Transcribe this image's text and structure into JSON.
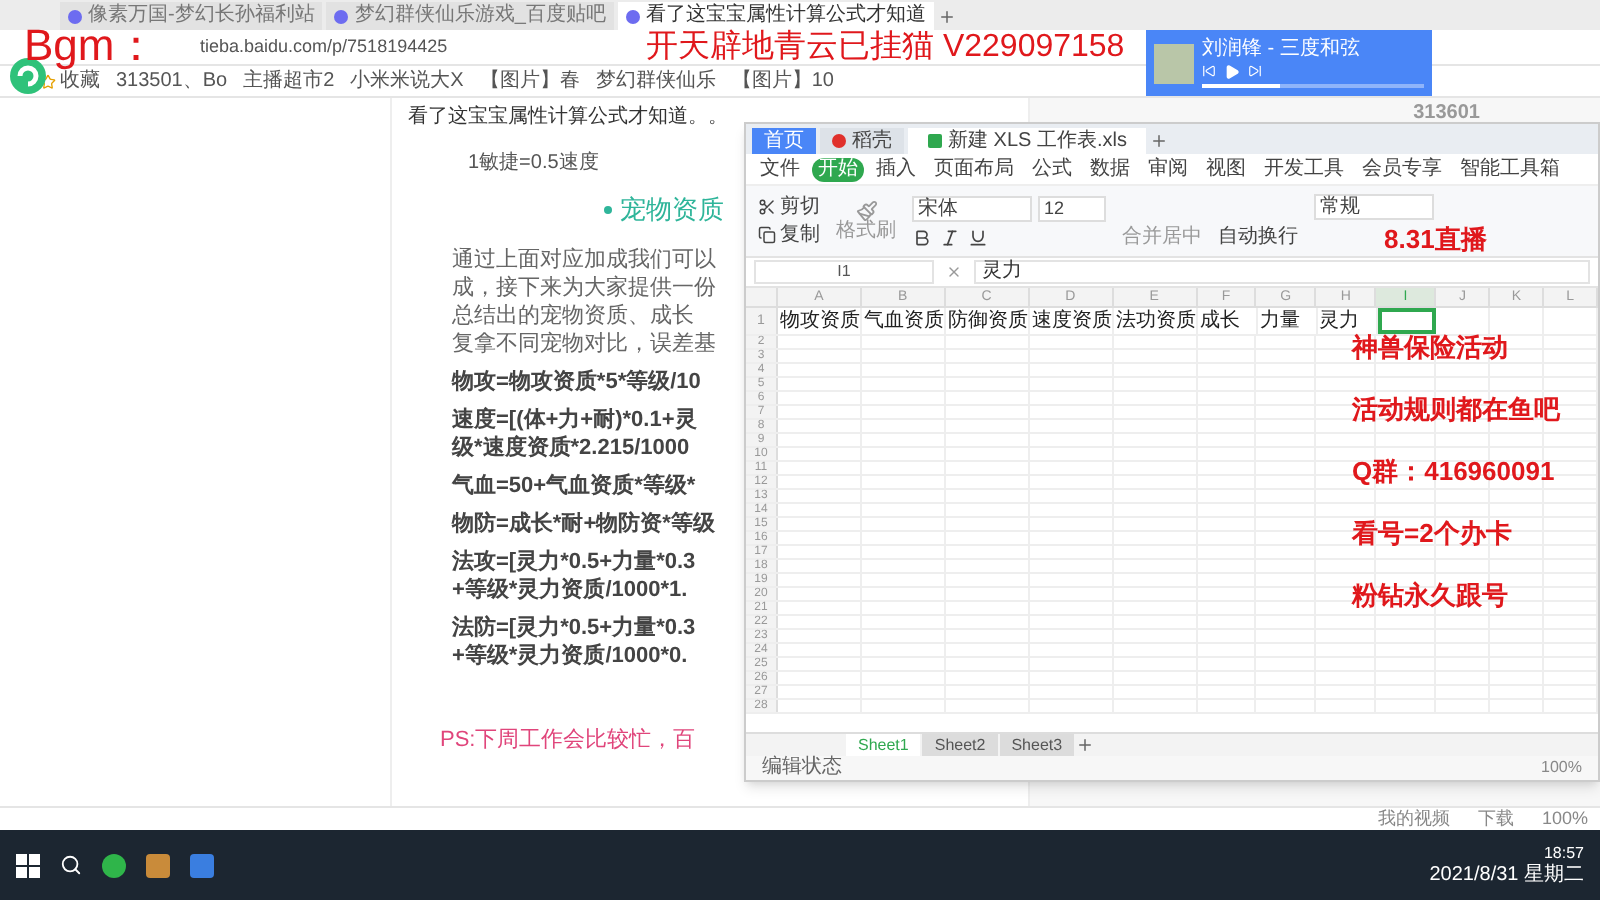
{
  "browser": {
    "tabs": [
      {
        "title": "像素万国-梦幻长孙福利站",
        "selected": false
      },
      {
        "title": "梦幻群侠仙乐游戏_百度贴吧",
        "selected": false
      },
      {
        "title": "看了这宝宝属性计算公式才知道",
        "selected": true
      }
    ],
    "address": "tieba.baidu.com/p/7518194425",
    "bookmarks": [
      "收藏",
      "313501、Bo",
      "主播超市2",
      "小米米说大X",
      "【图片】春",
      "梦幻群侠仙乐",
      "【图片】10"
    ],
    "side_number": "313601",
    "status_items": [
      "我的视频",
      "下载",
      "100%"
    ]
  },
  "article": {
    "title": "看了这宝宝属性计算公式才知道。。",
    "top_line": "1敏捷=0.5速度",
    "section": "宠物资质",
    "blocks": [
      {
        "kind": "text",
        "lines": [
          "通过上面对应加成我们可以",
          "成，接下来为大家提供一份",
          "总结出的宠物资质、成长",
          "复拿不同宠物对比，误差基"
        ]
      },
      {
        "kind": "formula",
        "lines": [
          "物攻=物攻资质*5*等级/10"
        ]
      },
      {
        "kind": "formula",
        "lines": [
          "速度=[(体+力+耐)*0.1+灵",
          "级*速度资质*2.215/1000"
        ]
      },
      {
        "kind": "formula",
        "lines": [
          "气血=50+气血资质*等级*"
        ]
      },
      {
        "kind": "formula",
        "lines": [
          "物防=成长*耐+物防资*等级"
        ]
      },
      {
        "kind": "formula",
        "lines": [
          "法攻=[灵力*0.5+力量*0.3",
          "+等级*灵力资质/1000*1."
        ]
      },
      {
        "kind": "formula",
        "lines": [
          "法防=[灵力*0.5+力量*0.3",
          "+等级*灵力资质/1000*0."
        ]
      }
    ],
    "ps": "PS:下周工作会比较忙，百"
  },
  "sheet": {
    "tabs": [
      {
        "title": "首页",
        "kind": "home"
      },
      {
        "title": "稻壳",
        "kind": "store"
      },
      {
        "title": "新建 XLS 工作表.xls",
        "kind": "file"
      }
    ],
    "menu": [
      {
        "label": "文件",
        "selected": false
      },
      {
        "label": "开始",
        "selected": true
      },
      {
        "label": "插入",
        "selected": false
      },
      {
        "label": "页面布局",
        "selected": false
      },
      {
        "label": "公式",
        "selected": false
      },
      {
        "label": "数据",
        "selected": false
      },
      {
        "label": "审阅",
        "selected": false
      },
      {
        "label": "视图",
        "selected": false
      },
      {
        "label": "开发工具",
        "selected": false
      },
      {
        "label": "会员专享",
        "selected": false
      },
      {
        "label": "智能工具箱",
        "selected": false
      }
    ],
    "ribbon": {
      "cut": "剪切",
      "copy": "复制",
      "painter": "格式刷",
      "font": "宋体",
      "size": "12",
      "merge": "合并居中",
      "wrap": "自动换行",
      "format": "常规"
    },
    "cell_ref": "I1",
    "formula": "灵力",
    "columns": [
      {
        "name": "A",
        "selected": false
      },
      {
        "name": "B",
        "selected": false
      },
      {
        "name": "C",
        "selected": false
      },
      {
        "name": "D",
        "selected": false
      },
      {
        "name": "E",
        "selected": false
      },
      {
        "name": "F",
        "selected": false
      },
      {
        "name": "G",
        "selected": false
      },
      {
        "name": "H",
        "selected": false
      },
      {
        "name": "I",
        "selected": true
      },
      {
        "name": "J",
        "selected": false
      },
      {
        "name": "K",
        "selected": false
      },
      {
        "name": "L",
        "selected": false
      }
    ],
    "header_row": [
      "物攻资质",
      "气血资质",
      "防御资质",
      "速度资质",
      "法功资质",
      "成长",
      "力量",
      "灵力"
    ],
    "row_numbers": [
      "1",
      "2",
      "3",
      "4",
      "5",
      "6",
      "7",
      "8",
      "9",
      "10",
      "11",
      "12",
      "13",
      "14",
      "15",
      "16",
      "17",
      "18",
      "19",
      "20",
      "21",
      "22",
      "23",
      "24",
      "25",
      "26",
      "27",
      "28"
    ],
    "sheets": [
      {
        "name": "Sheet1",
        "selected": true
      },
      {
        "name": "Sheet2",
        "selected": false
      },
      {
        "name": "Sheet3",
        "selected": false
      }
    ],
    "status": "编辑状态",
    "zoom": "100%"
  },
  "music": {
    "title": "刘润锋 - 三度和弦",
    "level": 0.35
  },
  "overlay": {
    "bgm": "Bgm：",
    "headline": "开天辟地青云已挂猫 V229097158",
    "live": "8.31直播",
    "notes": [
      "神兽保险活动",
      "活动规则都在鱼吧",
      "Q群：416960091",
      "看号=2个办卡",
      "粉钻永久跟号"
    ]
  },
  "taskbar": {
    "time": "18:57",
    "date": "2021/8/31 星期二"
  }
}
